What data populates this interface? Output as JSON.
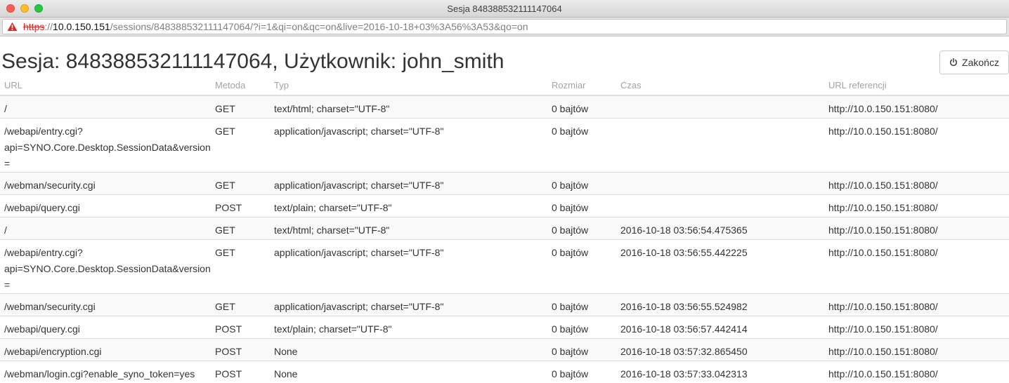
{
  "window": {
    "title": "Sesja 848388532111147064"
  },
  "address_bar": {
    "protocol": "https",
    "separator": "://",
    "host": "10.0.150.151",
    "path": "/sessions/848388532111147064/?i=1&qi=on&qc=on&live=2016-10-18+03%3A56%3A53&qo=on"
  },
  "header": {
    "title": "Sesja: 848388532111147064, Użytkownik: john_smith",
    "end_button_label": "Zakończ"
  },
  "table": {
    "columns": [
      "URL",
      "Metoda",
      "Typ",
      "Rozmiar",
      "Czas",
      "URL referencji"
    ],
    "rows": [
      {
        "url_lines": [
          "/"
        ],
        "method": "GET",
        "type": "text/html; charset=\"UTF-8\"",
        "size": "0 bajtów",
        "time": "",
        "referrer": "http://10.0.150.151:8080/"
      },
      {
        "url_lines": [
          "/webapi/entry.cgi?",
          "api=SYNO.Core.Desktop.SessionData&version="
        ],
        "method": "GET",
        "type": "application/javascript; charset=\"UTF-8\"",
        "size": "0 bajtów",
        "time": "",
        "referrer": "http://10.0.150.151:8080/"
      },
      {
        "url_lines": [
          "/webman/security.cgi"
        ],
        "method": "GET",
        "type": "application/javascript; charset=\"UTF-8\"",
        "size": "0 bajtów",
        "time": "",
        "referrer": "http://10.0.150.151:8080/"
      },
      {
        "url_lines": [
          "/webapi/query.cgi"
        ],
        "method": "POST",
        "type": "text/plain; charset=\"UTF-8\"",
        "size": "0 bajtów",
        "time": "",
        "referrer": "http://10.0.150.151:8080/"
      },
      {
        "url_lines": [
          "/"
        ],
        "method": "GET",
        "type": "text/html; charset=\"UTF-8\"",
        "size": "0 bajtów",
        "time": "2016-10-18 03:56:54.475365",
        "referrer": "http://10.0.150.151:8080/"
      },
      {
        "url_lines": [
          "/webapi/entry.cgi?",
          "api=SYNO.Core.Desktop.SessionData&version="
        ],
        "method": "GET",
        "type": "application/javascript; charset=\"UTF-8\"",
        "size": "0 bajtów",
        "time": "2016-10-18 03:56:55.442225",
        "referrer": "http://10.0.150.151:8080/"
      },
      {
        "url_lines": [
          "/webman/security.cgi"
        ],
        "method": "GET",
        "type": "application/javascript; charset=\"UTF-8\"",
        "size": "0 bajtów",
        "time": "2016-10-18 03:56:55.524982",
        "referrer": "http://10.0.150.151:8080/"
      },
      {
        "url_lines": [
          "/webapi/query.cgi"
        ],
        "method": "POST",
        "type": "text/plain; charset=\"UTF-8\"",
        "size": "0 bajtów",
        "time": "2016-10-18 03:56:57.442414",
        "referrer": "http://10.0.150.151:8080/"
      },
      {
        "url_lines": [
          "/webapi/encryption.cgi"
        ],
        "method": "POST",
        "type": "None",
        "size": "0 bajtów",
        "time": "2016-10-18 03:57:32.865450",
        "referrer": "http://10.0.150.151:8080/"
      },
      {
        "url_lines": [
          "/webman/login.cgi?enable_syno_token=yes"
        ],
        "method": "POST",
        "type": "None",
        "size": "0 bajtów",
        "time": "2016-10-18 03:57:33.042313",
        "referrer": "http://10.0.150.151:8080/"
      }
    ]
  },
  "icons": {
    "security_warning": "warning-triangle-icon",
    "end_button": "power-icon"
  },
  "colors": {
    "warning": "#c9302c",
    "stripe": "#f9f9f9",
    "border": "#dddddd"
  }
}
